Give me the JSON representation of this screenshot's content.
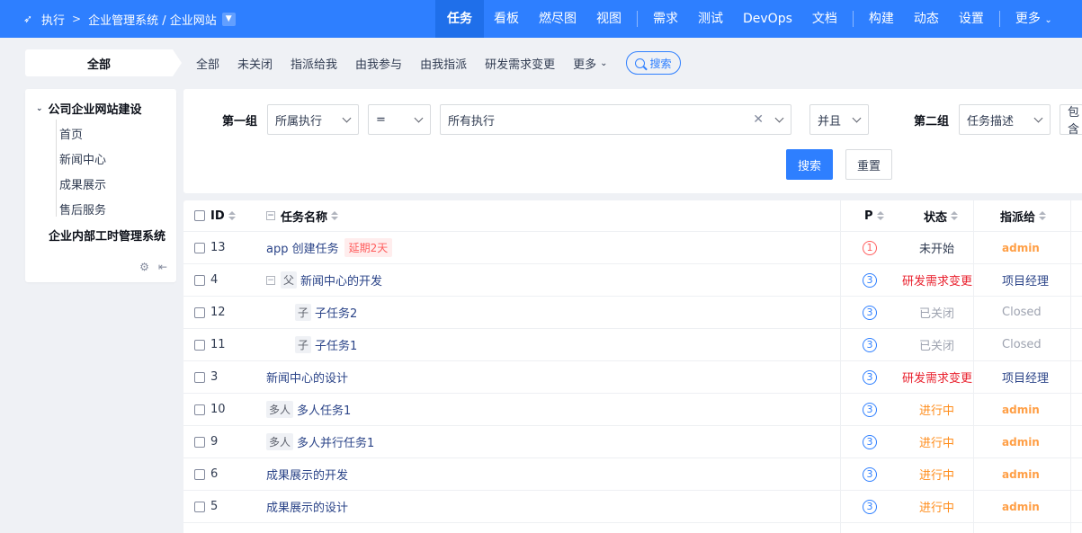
{
  "breadcrumb": {
    "module": "执行",
    "path": "企业管理系统 / 企业网站"
  },
  "nav": [
    "任务",
    "看板",
    "燃尽图",
    "视图",
    "需求",
    "测试",
    "DevOps",
    "文档",
    "构建",
    "动态",
    "设置",
    "更多"
  ],
  "subnav": {
    "all": "全部",
    "items": [
      "全部",
      "未关闭",
      "指派给我",
      "由我参与",
      "由我指派",
      "研发需求变更"
    ],
    "more": "更多",
    "search": "搜索"
  },
  "sidebar": {
    "root": "公司企业网站建设",
    "children": [
      "首页",
      "新闻中心",
      "成果展示",
      "售后服务"
    ],
    "root2": "企业内部工时管理系统"
  },
  "filter": {
    "group1_label": "第一组",
    "field1": "所属执行",
    "op1": "=",
    "value1": "所有执行",
    "logic": "并且",
    "group2_label": "第二组",
    "field2": "任务描述",
    "op2": "包含",
    "search_btn": "搜索",
    "reset_btn": "重置"
  },
  "table": {
    "headers": {
      "id": "ID",
      "name": "任务名称",
      "pri": "P",
      "status": "状态",
      "assigned": "指派给"
    },
    "rows": [
      {
        "id": "13",
        "name": "app 创建任务",
        "tag": "延期2天",
        "pri": "1",
        "status": "未开始",
        "assigned": "admin"
      },
      {
        "id": "4",
        "badge": "父",
        "name": "新闻中心的开发",
        "pri": "3",
        "status": "研发需求变更",
        "assigned": "项目经理"
      },
      {
        "id": "12",
        "badge": "子",
        "name": "子任务2",
        "pri": "3",
        "status": "已关闭",
        "assigned": "Closed"
      },
      {
        "id": "11",
        "badge": "子",
        "name": "子任务1",
        "pri": "3",
        "status": "已关闭",
        "assigned": "Closed"
      },
      {
        "id": "3",
        "name": "新闻中心的设计",
        "pri": "3",
        "status": "研发需求变更",
        "assigned": "项目经理"
      },
      {
        "id": "10",
        "badge": "多人",
        "name": "多人任务1",
        "pri": "3",
        "status": "进行中",
        "assigned": "admin"
      },
      {
        "id": "9",
        "badge": "多人",
        "name": "多人并行任务1",
        "pri": "3",
        "status": "进行中",
        "assigned": "admin"
      },
      {
        "id": "6",
        "name": "成果展示的开发",
        "pri": "3",
        "status": "进行中",
        "assigned": "admin"
      },
      {
        "id": "5",
        "name": "成果展示的设计",
        "pri": "3",
        "status": "进行中",
        "assigned": "admin"
      }
    ]
  },
  "colors": {
    "primary": "#2e7fff",
    "status_red": "#e9202d",
    "status_orange": "#ff8c1a",
    "admin": "#ff9f46"
  }
}
